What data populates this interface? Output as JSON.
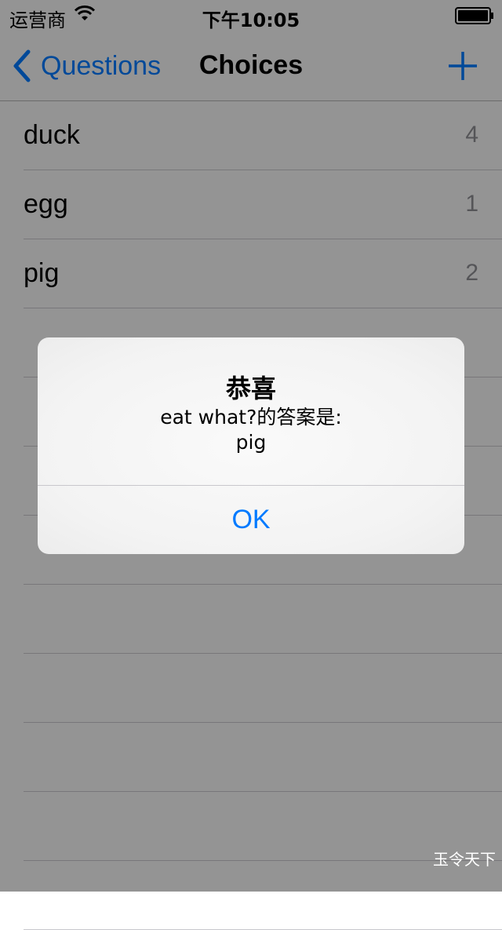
{
  "status_bar": {
    "carrier": "运营商",
    "time": "下午10:05"
  },
  "nav": {
    "back_label": "Questions",
    "title": "Choices",
    "add_icon": "plus-icon"
  },
  "choices": [
    {
      "label": "duck",
      "count": "4"
    },
    {
      "label": "egg",
      "count": "1"
    },
    {
      "label": "pig",
      "count": "2"
    }
  ],
  "alert": {
    "title": "恭喜",
    "message_line1": "eat what?的答案是:",
    "message_line2": "pig",
    "ok_label": "OK"
  },
  "watermark": "玉令天下",
  "colors": {
    "accent": "#007aff",
    "dim_overlay": "rgba(0,0,0,0.4)"
  }
}
